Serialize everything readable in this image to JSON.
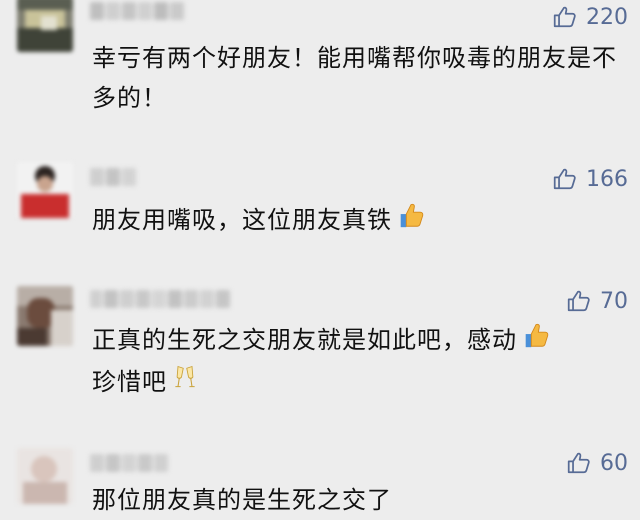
{
  "comments": [
    {
      "likes": "220",
      "text": "幸亏有两个好朋友！能用嘴帮你吸毒的朋友是不多的！",
      "emoji": ""
    },
    {
      "likes": "166",
      "text": "朋友用嘴吸，这位朋友真铁",
      "emoji": "thumbs-up-emoji"
    },
    {
      "likes": "70",
      "text": "正真的生死之交朋友就是如此吧，感动",
      "text2": "珍惜吧",
      "emoji": "thumbs-up-emoji",
      "emoji2": "cheers-emoji"
    },
    {
      "likes": "60",
      "text": "那位朋友真的是生死之交了",
      "emoji": ""
    }
  ],
  "colors": {
    "background": "#ededed",
    "like_text": "#576b95",
    "comment_text": "#111111"
  },
  "icons": {
    "like": "thumbs-up-outline-icon"
  }
}
